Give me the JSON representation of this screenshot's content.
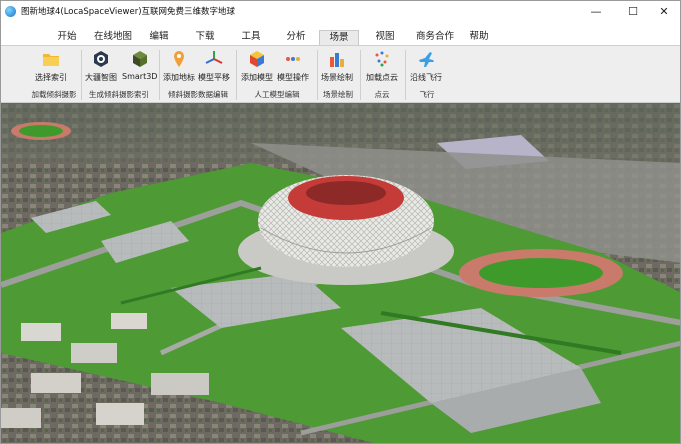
{
  "window": {
    "title": "图新地球4(LocaSpaceViewer)互联网免费三维数字地球",
    "minimize_glyph": "—",
    "maximize_glyph": "☐",
    "close_glyph": "✕"
  },
  "menu": {
    "tabs": [
      "开始",
      "在线地图",
      "编辑",
      "下载",
      "工具",
      "分析",
      "场景",
      "视图",
      "商务合作",
      "帮助"
    ],
    "active_tab": "场景"
  },
  "ribbon": {
    "buttons": [
      {
        "label": "选择索引",
        "icon": "folder-icon"
      },
      {
        "label": "大疆智图",
        "icon": "dji-icon"
      },
      {
        "label": "Smart3D",
        "icon": "smart3d-cube-icon"
      },
      {
        "label": "添加地标",
        "icon": "placemark-icon"
      },
      {
        "label": "模型平移",
        "icon": "move-axes-icon"
      },
      {
        "label": "添加模型",
        "icon": "add-model-cube-icon"
      },
      {
        "label": "模型操作",
        "icon": "model-operate-icon"
      },
      {
        "label": "场景绘制",
        "icon": "scene-draw-icon"
      },
      {
        "label": "加载点云",
        "icon": "point-cloud-icon"
      },
      {
        "label": "沿线飞行",
        "icon": "airplane-icon"
      }
    ],
    "groups": [
      "加载倾斜摄影",
      "生成倾斜摄影索引",
      "倾斜摄影数据编辑",
      "人工模型编辑",
      "场景绘制",
      "点云",
      "飞行"
    ]
  },
  "colors": {
    "ribbon_bg": "#eeeeee",
    "grass": "#3f9a2c",
    "track": "#c97a6a",
    "stadium_red": "#c53b38",
    "plaza": "#b9bcbd"
  }
}
